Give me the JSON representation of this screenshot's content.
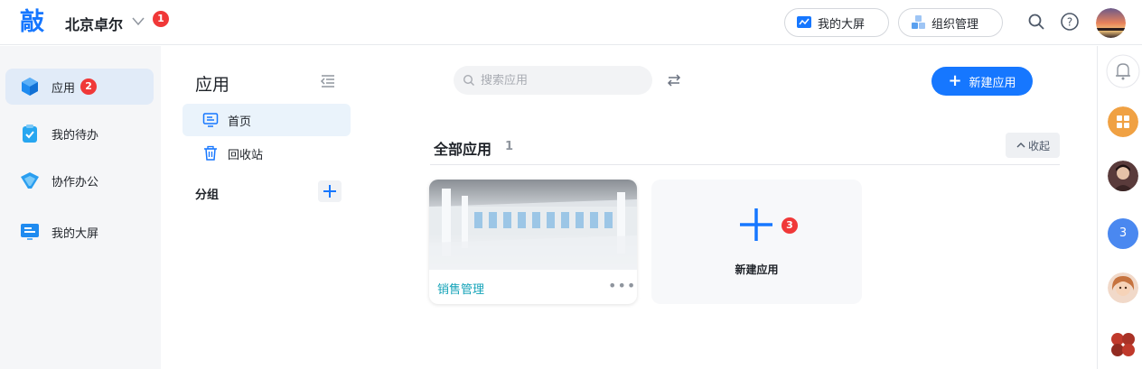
{
  "header": {
    "logo_text": "敲",
    "org_name": "北京卓尔",
    "org_badge": "1",
    "big_screen_label": "我的大屏",
    "org_manage_label": "组织管理"
  },
  "left_nav": {
    "items": [
      {
        "label": "应用",
        "badge": "2"
      },
      {
        "label": "我的待办"
      },
      {
        "label": "协作办公"
      },
      {
        "label": "我的大屏"
      }
    ]
  },
  "sub_nav": {
    "title": "应用",
    "items": [
      {
        "label": "首页"
      },
      {
        "label": "回收站"
      }
    ],
    "group_label": "分组"
  },
  "main": {
    "search_placeholder": "搜索应用",
    "new_app_button": "新建应用",
    "section_title": "全部应用",
    "section_count": "1",
    "collapse_label": "收起",
    "apps": [
      {
        "name": "销售管理",
        "more": "•••"
      }
    ],
    "new_card_label": "新建应用",
    "new_card_badge": "3"
  },
  "right_rail": {
    "count_badge": "3"
  },
  "colors": {
    "primary": "#1677ff",
    "badge": "#f03838",
    "app_name": "#14a3b8"
  }
}
